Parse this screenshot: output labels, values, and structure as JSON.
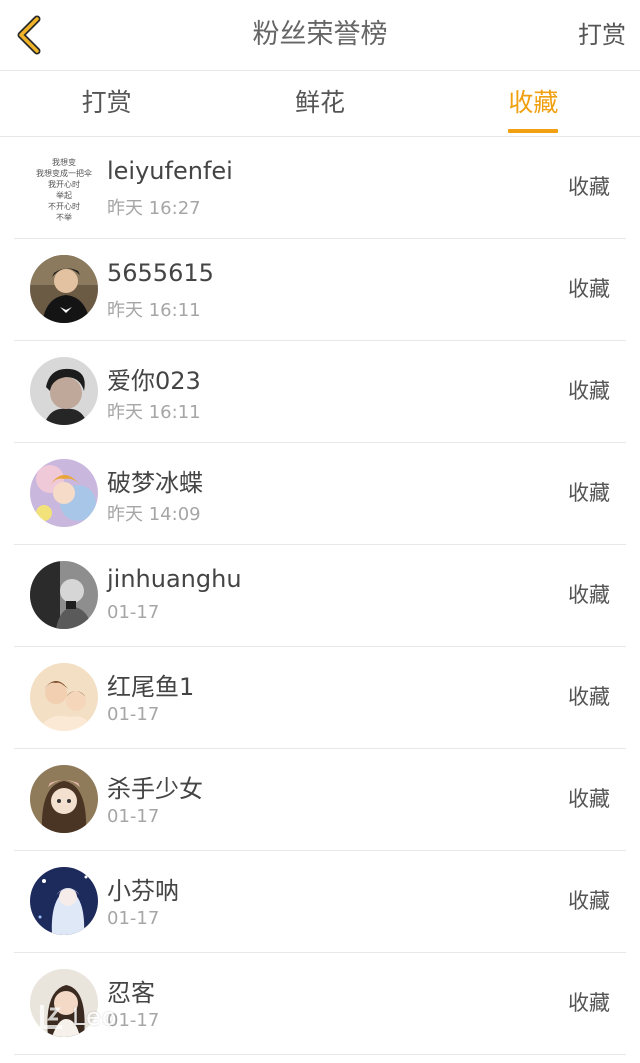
{
  "header": {
    "title": "粉丝荣誉榜",
    "back_icon": "chevron-left-icon",
    "right_action": "打赏",
    "accent_color": "#f0a011"
  },
  "tabs": [
    {
      "label": "打赏",
      "active": false
    },
    {
      "label": "鲜花",
      "active": false
    },
    {
      "label": "收藏",
      "active": true
    }
  ],
  "fans": [
    {
      "name": "leiyufenfei",
      "time": "昨天 16:27",
      "action": "收藏",
      "avatar_text": [
        "我想变",
        "我想变成一把伞",
        "我开心时",
        "举起",
        "不开心时",
        "不举"
      ]
    },
    {
      "name": "5655615",
      "time": "昨天 16:11",
      "action": "收藏"
    },
    {
      "name": "爱你023",
      "time": "昨天 16:11",
      "action": "收藏"
    },
    {
      "name": "破梦冰蝶",
      "time": "昨天 14:09",
      "action": "收藏"
    },
    {
      "name": "jinhuanghu",
      "time": "01-17",
      "action": "收藏"
    },
    {
      "name": "红尾鱼1",
      "time": "01-17",
      "action": "收藏"
    },
    {
      "name": "杀手少女",
      "time": "01-17",
      "action": "收藏"
    },
    {
      "name": "小芬呐",
      "time": "01-17",
      "action": "收藏"
    },
    {
      "name": "忍客",
      "time": "01-17",
      "action": "收藏"
    }
  ],
  "watermark": {
    "text": "Leo"
  }
}
